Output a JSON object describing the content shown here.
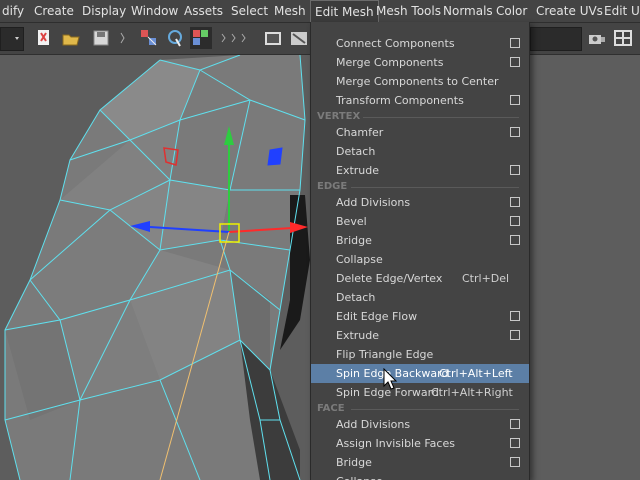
{
  "menubar": {
    "items": [
      {
        "label": "dify"
      },
      {
        "label": "Create"
      },
      {
        "label": "Display"
      },
      {
        "label": "Window"
      },
      {
        "label": "Assets"
      },
      {
        "label": "Select"
      },
      {
        "label": "Mesh"
      },
      {
        "label": "Edit Mesh"
      },
      {
        "label": "Mesh Tools"
      },
      {
        "label": "Normals"
      },
      {
        "label": "Color"
      },
      {
        "label": "Create UVs"
      },
      {
        "label": "Edit UV"
      }
    ]
  },
  "edit_mesh_menu": {
    "items_top": [
      {
        "label": "Connect Components",
        "has_option": true
      },
      {
        "label": "Merge Components",
        "has_option": true
      },
      {
        "label": "Merge Components to Center",
        "has_option": false
      },
      {
        "label": "Transform Components",
        "has_option": true
      }
    ],
    "vertex": {
      "title": "VERTEX",
      "items": [
        {
          "label": "Chamfer",
          "has_option": true
        },
        {
          "label": "Detach",
          "has_option": false
        },
        {
          "label": "Extrude",
          "has_option": true
        }
      ]
    },
    "edge": {
      "title": "EDGE",
      "items": [
        {
          "label": "Add Divisions",
          "has_option": true
        },
        {
          "label": "Bevel",
          "has_option": true
        },
        {
          "label": "Bridge",
          "has_option": true
        },
        {
          "label": "Collapse",
          "has_option": false
        },
        {
          "label": "Delete Edge/Vertex",
          "shortcut": "Ctrl+Del",
          "has_option": false
        },
        {
          "label": "Detach",
          "has_option": false
        },
        {
          "label": "Edit Edge Flow",
          "has_option": true
        },
        {
          "label": "Extrude",
          "has_option": true
        },
        {
          "label": "Flip Triangle Edge",
          "has_option": false
        },
        {
          "label": "Spin Edge Backward",
          "shortcut": "Ctrl+Alt+Left",
          "has_option": false,
          "highlighted": true
        },
        {
          "label": "Spin Edge Forward",
          "shortcut": "Ctrl+Alt+Right",
          "has_option": false
        }
      ]
    },
    "face": {
      "title": "FACE",
      "items": [
        {
          "label": "Add Divisions",
          "has_option": true
        },
        {
          "label": "Assign Invisible Faces",
          "has_option": true
        },
        {
          "label": "Bridge",
          "has_option": true
        },
        {
          "label": "Collapse",
          "has_option": false
        }
      ]
    }
  },
  "colors": {
    "menu_bg": "#444444",
    "highlight": "#5c7fa6",
    "wireframe": "#5fe0ee",
    "viewport_bg": "#5d5d5d"
  },
  "icons": [
    "chevron-down-icon",
    "new-scene-icon",
    "open-folder-icon",
    "save-icon",
    "select-icon",
    "lasso-icon",
    "paint-select-icon",
    "render-icon",
    "ipr-icon",
    "camera-icon",
    "layout-icon"
  ]
}
